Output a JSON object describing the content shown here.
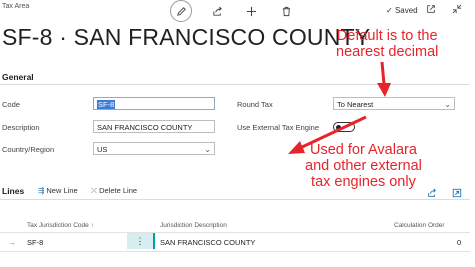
{
  "header": {
    "breadcrumb": "Tax Area",
    "title": "SF-8 · SAN FRANCISCO COUNTY",
    "saved_label": "Saved"
  },
  "general": {
    "section_title": "General",
    "code_label": "Code",
    "code_value": "SF-8",
    "description_label": "Description",
    "description_value": "SAN FRANCISCO COUNTY",
    "country_label": "Country/Region",
    "country_value": "US",
    "round_tax_label": "Round Tax",
    "round_tax_value": "To Nearest",
    "use_external_label": "Use External Tax Engine"
  },
  "annotations": {
    "top_line1": "Default is to the",
    "top_line2": "nearest decimal",
    "bottom_line1": "Used for Avalara",
    "bottom_line2": "and other external",
    "bottom_line3": "tax engines only"
  },
  "lines": {
    "title": "Lines",
    "new_line": "New Line",
    "delete_line": "Delete Line",
    "columns": [
      "Tax Jurisdiction Code ↑",
      "Jurisdiction Description",
      "Calculation Order"
    ],
    "rows": [
      {
        "code": "SF-8",
        "description": "SAN FRANCISCO COUNTY",
        "order": "0"
      }
    ]
  },
  "colors": {
    "annotation": "#e8242a",
    "selection": "#3b7dd8",
    "accent": "#00a0a0"
  },
  "icons": [
    "pencil-icon",
    "share-icon",
    "plus-icon",
    "trash-icon",
    "check-icon",
    "popout-icon",
    "collapse-icon",
    "new-line-icon",
    "delete-line-icon",
    "row-arrow-icon",
    "share-lines-icon",
    "expand-lines-icon"
  ]
}
